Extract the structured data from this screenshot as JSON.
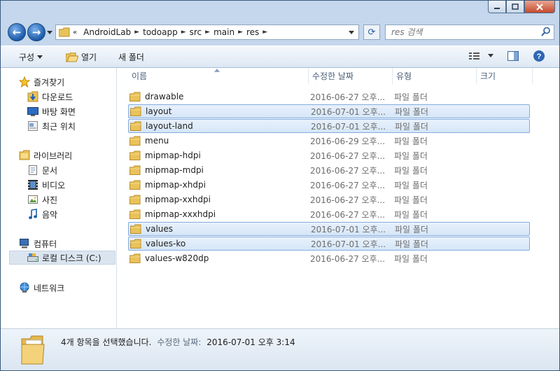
{
  "navbar": {
    "breadcrumbs": [
      "AndroidLab",
      "todoapp",
      "src",
      "main",
      "res"
    ],
    "search_placeholder": "res 검색"
  },
  "toolbar": {
    "organize": "구성",
    "open": "열기",
    "new_folder": "새 폴더"
  },
  "sidebar": {
    "favorites": {
      "label": "즐겨찾기",
      "items": [
        "다운로드",
        "바탕 화면",
        "최근 위치"
      ]
    },
    "libraries": {
      "label": "라이브러리",
      "items": [
        "문서",
        "비디오",
        "사진",
        "음악"
      ]
    },
    "computer": {
      "label": "컴퓨터",
      "items": [
        "로컬 디스크 (C:)"
      ]
    },
    "network": {
      "label": "네트워크"
    }
  },
  "columns": {
    "name": "이름",
    "date": "수정한 날짜",
    "type": "유형",
    "size": "크기"
  },
  "files": [
    {
      "name": "drawable",
      "date": "2016-06-27 오후...",
      "type": "파일 폴더",
      "selected": false
    },
    {
      "name": "layout",
      "date": "2016-07-01 오후...",
      "type": "파일 폴더",
      "selected": true
    },
    {
      "name": "layout-land",
      "date": "2016-07-01 오후...",
      "type": "파일 폴더",
      "selected": true
    },
    {
      "name": "menu",
      "date": "2016-06-29 오후...",
      "type": "파일 폴더",
      "selected": false
    },
    {
      "name": "mipmap-hdpi",
      "date": "2016-06-27 오후...",
      "type": "파일 폴더",
      "selected": false
    },
    {
      "name": "mipmap-mdpi",
      "date": "2016-06-27 오후...",
      "type": "파일 폴더",
      "selected": false
    },
    {
      "name": "mipmap-xhdpi",
      "date": "2016-06-27 오후...",
      "type": "파일 폴더",
      "selected": false
    },
    {
      "name": "mipmap-xxhdpi",
      "date": "2016-06-27 오후...",
      "type": "파일 폴더",
      "selected": false
    },
    {
      "name": "mipmap-xxxhdpi",
      "date": "2016-06-27 오후...",
      "type": "파일 폴더",
      "selected": false
    },
    {
      "name": "values",
      "date": "2016-07-01 오후...",
      "type": "파일 폴더",
      "selected": true
    },
    {
      "name": "values-ko",
      "date": "2016-07-01 오후...",
      "type": "파일 폴더",
      "selected": true
    },
    {
      "name": "values-w820dp",
      "date": "2016-06-27 오후...",
      "type": "파일 폴더",
      "selected": false
    }
  ],
  "status": {
    "selection": "4개 항목을 선택했습니다.",
    "date_label": "수정한 날짜:",
    "date_value": "2016-07-01 오후 3:14"
  }
}
